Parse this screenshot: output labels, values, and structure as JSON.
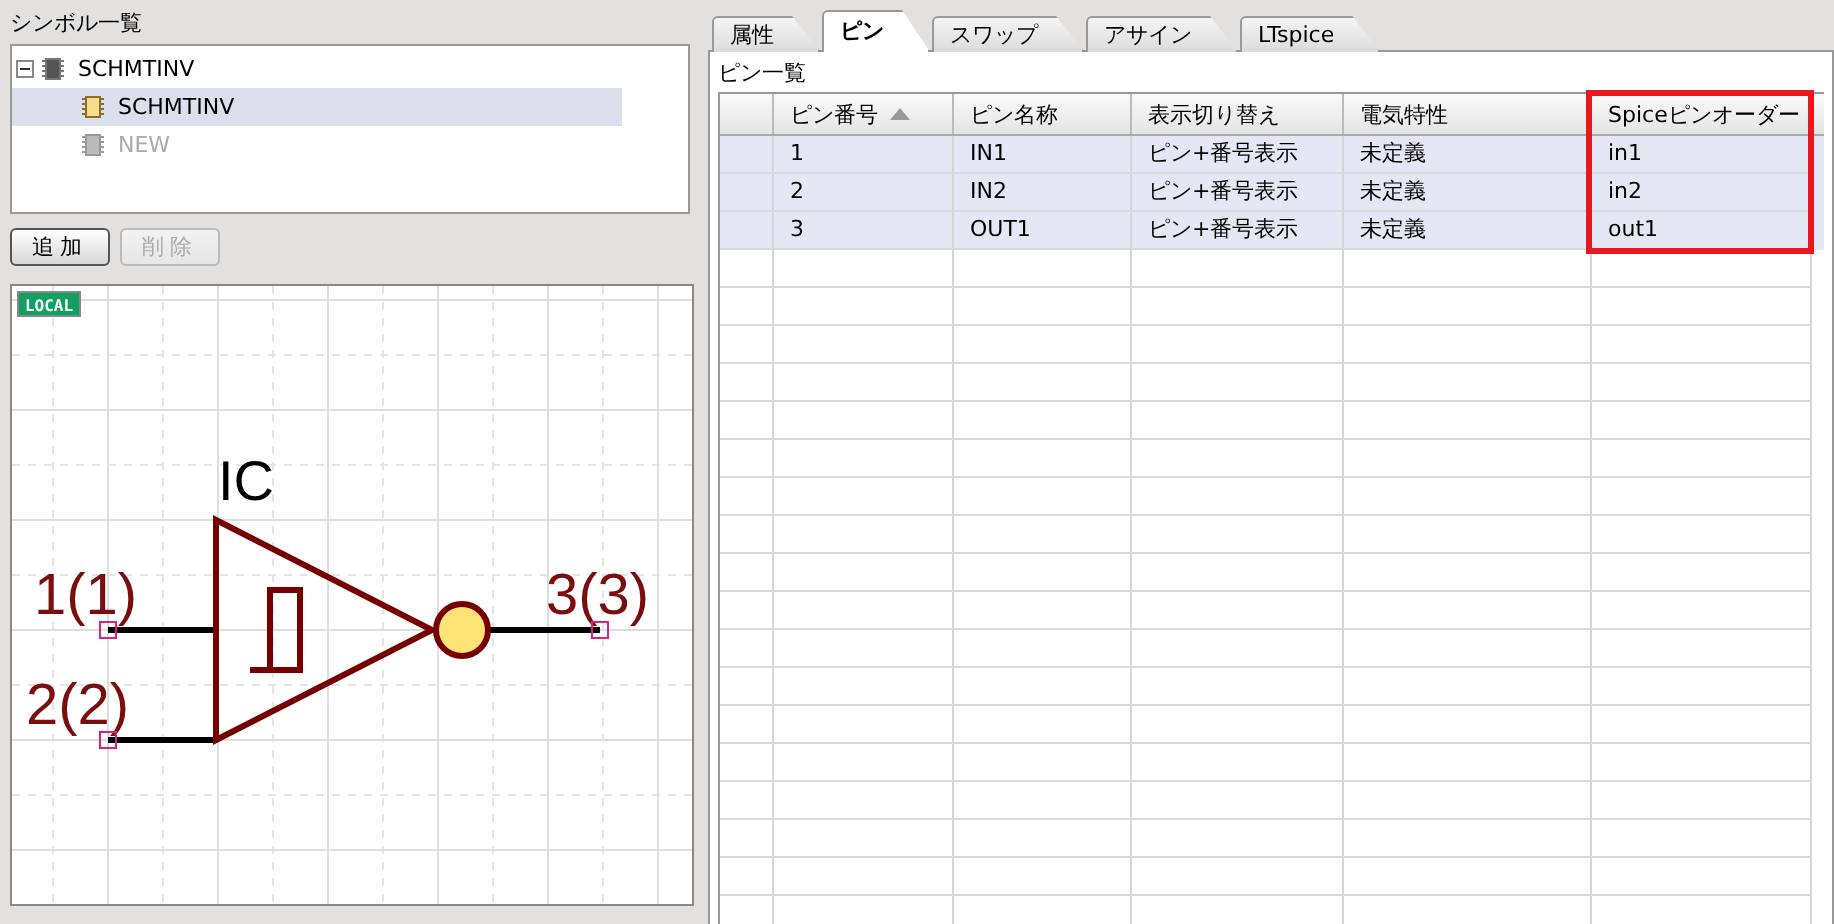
{
  "symbol_list": {
    "title": "シンボル一覧",
    "tree": [
      {
        "label": "SCHMTINV",
        "expanded": true,
        "children": [
          {
            "label": "SCHMTINV",
            "selected": true,
            "disabled": false
          },
          {
            "label": "NEW",
            "selected": false,
            "disabled": true
          }
        ]
      }
    ],
    "buttons": [
      {
        "label": "追加",
        "disabled": false
      },
      {
        "label": "削除",
        "disabled": true
      }
    ]
  },
  "preview": {
    "badge": "LOCAL",
    "ref_label": "IC",
    "pins": [
      {
        "label": "1(1)"
      },
      {
        "label": "2(2)"
      },
      {
        "label": "3(3)"
      }
    ]
  },
  "tabs": [
    {
      "label": "属性",
      "selected": false
    },
    {
      "label": "ピン",
      "selected": true
    },
    {
      "label": "スワップ",
      "selected": false
    },
    {
      "label": "アサイン",
      "selected": false
    },
    {
      "label": "LTspice",
      "selected": false
    }
  ],
  "pin_table": {
    "title": "ピン一覧",
    "columns": [
      {
        "label": "ピン番号",
        "sorted": true,
        "highlighted": false
      },
      {
        "label": "ピン名称",
        "sorted": false,
        "highlighted": false
      },
      {
        "label": "表示切り替え",
        "sorted": false,
        "highlighted": false
      },
      {
        "label": "電気特性",
        "sorted": false,
        "highlighted": false
      },
      {
        "label": "Spiceピンオーダー",
        "sorted": false,
        "highlighted": true
      }
    ],
    "rows": [
      {
        "selected": true,
        "cells": [
          "1",
          "IN1",
          "ピン+番号表示",
          "未定義",
          "in1"
        ]
      },
      {
        "selected": true,
        "cells": [
          "2",
          "IN2",
          "ピン+番号表示",
          "未定義",
          "in2"
        ]
      },
      {
        "selected": true,
        "cells": [
          "3",
          "OUT1",
          "ピン+番号表示",
          "未定義",
          "out1"
        ]
      }
    ]
  }
}
